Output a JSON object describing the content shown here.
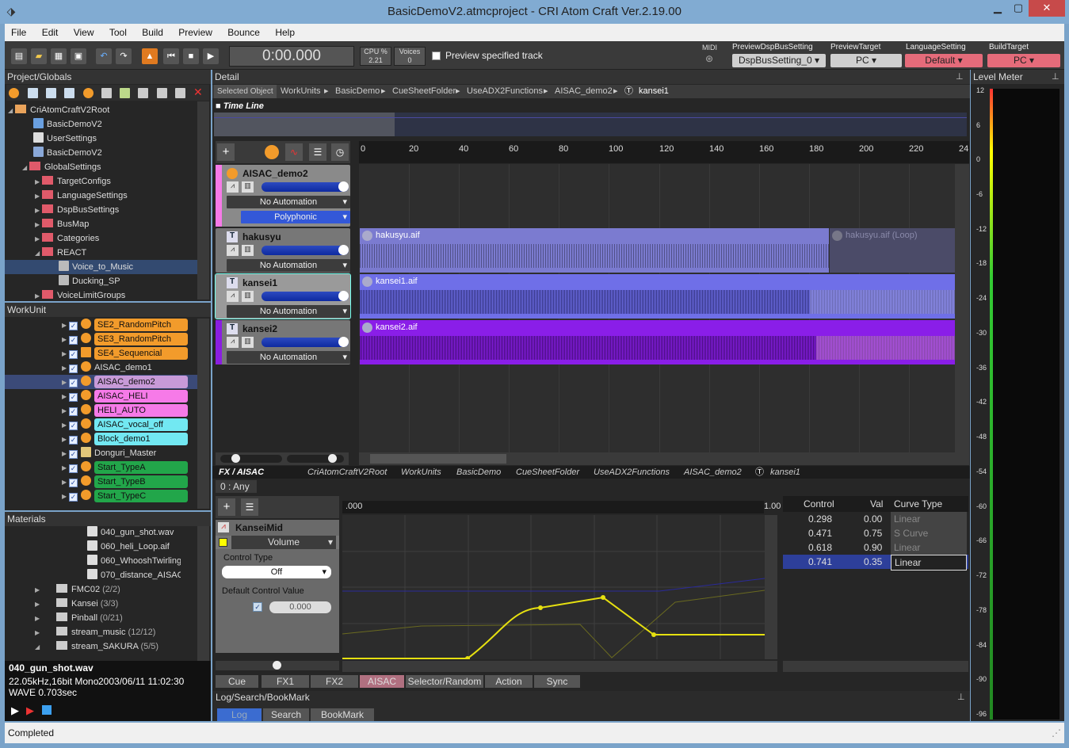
{
  "window": {
    "title": "BasicDemoV2.atmcproject - CRI Atom Craft Ver.2.19.00"
  },
  "menu": [
    "File",
    "Edit",
    "View",
    "Tool",
    "Build",
    "Preview",
    "Bounce",
    "Help"
  ],
  "toolbar": {
    "time": "0:00.000",
    "cpu_label": "CPU %",
    "cpu_value": "2.21",
    "voices_label": "Voices",
    "voices_value": "0",
    "preview_track": "Preview specified track",
    "midi": "MIDI",
    "selectors": [
      {
        "label": "PreviewDspBusSetting",
        "value": "DspBusSetting_0"
      },
      {
        "label": "PreviewTarget",
        "value": "PC"
      },
      {
        "label": "LanguageSetting",
        "value": "Default"
      },
      {
        "label": "BuildTarget",
        "value": "PC"
      }
    ]
  },
  "project": {
    "title": "Project/Globals",
    "items": [
      "CriAtomCraftV2Root",
      "BasicDemoV2",
      "UserSettings",
      "BasicDemoV2",
      "GlobalSettings",
      "TargetConfigs",
      "LanguageSettings",
      "DspBusSettings",
      "BusMap",
      "Categories",
      "REACT",
      "Voice_to_Music",
      "Ducking_SP",
      "VoiceLimitGroups"
    ]
  },
  "workunit": {
    "title": "WorkUnit",
    "items": [
      "SE2_RandomPitch",
      "SE3_RandomPitch",
      "SE4_Sequencial",
      "AISAC_demo1",
      "AISAC_demo2",
      "AISAC_HELI",
      "HELI_AUTO",
      "AISAC_vocal_off",
      "Block_demo1",
      "Donguri_Master",
      "Start_TypeA",
      "Start_TypeB",
      "Start_TypeC"
    ]
  },
  "materials": {
    "title": "Materials",
    "files": [
      "040_gun_shot.wav",
      "060_heli_Loop.aif",
      "060_WhooshTwirling",
      "070_distance_AISAC"
    ],
    "folders": [
      {
        "name": "FMC02",
        "count": "(2/2)"
      },
      {
        "name": "Kansei",
        "count": "(3/3)"
      },
      {
        "name": "Pinball",
        "count": "(0/21)"
      },
      {
        "name": "stream_music",
        "count": "(12/12)"
      },
      {
        "name": "stream_SAKURA",
        "count": "(5/5)"
      }
    ],
    "info_name": "040_gun_shot.wav",
    "info_format": "22.05kHz,16bit Mono",
    "info_date": "2003/06/11 11:02:30",
    "info_len": "WAVE 0.703sec"
  },
  "status": "Completed",
  "detail": {
    "title": "Detail",
    "selected": "Selected Object",
    "path": [
      "WorkUnits",
      "BasicDemo",
      "CueSheetFolder",
      "UseADX2Functions",
      "AISAC_demo2",
      "kansei1"
    ],
    "timeline": "Time Line",
    "ticks": [
      "0",
      "20",
      "40",
      "60",
      "80",
      "100",
      "120",
      "140",
      "160",
      "180",
      "200",
      "220",
      "24"
    ],
    "tracks": [
      {
        "name": "AISAC_demo2",
        "automation": "No Automation",
        "mode": "Polyphonic"
      },
      {
        "name": "hakusyu",
        "automation": "No Automation"
      },
      {
        "name": "kansei1",
        "automation": "No Automation"
      },
      {
        "name": "kansei2",
        "automation": "No Automation"
      }
    ],
    "clips": [
      "hakusyu.aif",
      "hakusyu.aif (Loop)",
      "kansei1.aif",
      "kansei2.aif"
    ]
  },
  "fx": {
    "title": "FX / AISAC",
    "path": [
      "CriAtomCraftV2Root",
      "WorkUnits",
      "BasicDemo",
      "CueSheetFolder",
      "UseADX2Functions",
      "AISAC_demo2",
      "kansei1"
    ],
    "any": "0 : Any",
    "aisac_name": "KanseiMid",
    "target": "Volume",
    "control_type_label": "Control Type",
    "control_type": "Off",
    "default_label": "Default Control Value",
    "default_value": "0.000",
    "axis_start": ".000",
    "axis_end": "1.00",
    "table_headers": [
      "Control",
      "Val",
      "Curve Type"
    ],
    "table": [
      {
        "c": "0.298",
        "v": "0.00",
        "t": "Linear"
      },
      {
        "c": "0.471",
        "v": "0.75",
        "t": "S Curve"
      },
      {
        "c": "0.618",
        "v": "0.90",
        "t": "Linear"
      },
      {
        "c": "0.741",
        "v": "0.35",
        "t": "Linear"
      }
    ],
    "tabs": [
      "Cue",
      "FX1",
      "FX2",
      "AISAC",
      "Selector/Random",
      "Action",
      "Sync"
    ]
  },
  "log": {
    "title": "Log/Search/BookMark",
    "tabs": [
      "Log",
      "Search",
      "BookMark"
    ]
  },
  "meter": {
    "title": "Level Meter",
    "labels": [
      "12",
      "6",
      "0",
      "-6",
      "-12",
      "-18",
      "-24",
      "-30",
      "-36",
      "-42",
      "-48",
      "-54",
      "-60",
      "-66",
      "-72",
      "-78",
      "-84",
      "-90",
      "-96"
    ]
  }
}
